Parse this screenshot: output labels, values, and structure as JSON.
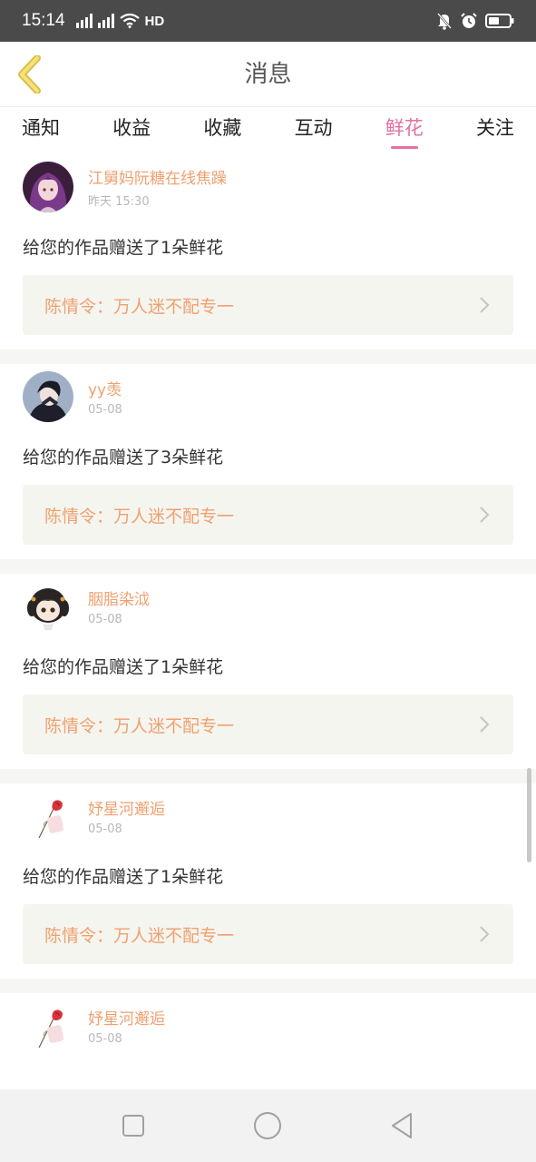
{
  "status_bar": {
    "time": "15:14",
    "signal1": "4G",
    "signal2": "4G",
    "hd": "HD"
  },
  "header": {
    "title": "消息",
    "back_icon": "chevron-left-icon"
  },
  "tabs": [
    {
      "label": "通知",
      "active": false
    },
    {
      "label": "收益",
      "active": false
    },
    {
      "label": "收藏",
      "active": false
    },
    {
      "label": "互动",
      "active": false
    },
    {
      "label": "鲜花",
      "active": true
    },
    {
      "label": "关注",
      "active": false
    }
  ],
  "colors": {
    "accent": "#e56fa1",
    "username": "#f0a070",
    "work_box_bg": "#f5f5ef"
  },
  "messages": [
    {
      "username": "江舅妈阮糖在线焦躁",
      "time": "昨天 15:30",
      "text": "给您的作品赠送了1朵鲜花",
      "work": "陈情令：万人迷不配专一",
      "avatar": "anime-girl-avatar"
    },
    {
      "username": "yy羡",
      "time": "05-08",
      "text": "给您的作品赠送了3朵鲜花",
      "work": "陈情令：万人迷不配专一",
      "avatar": "boy-avatar"
    },
    {
      "username": "胭脂染泧",
      "time": "05-08",
      "text": "给您的作品赠送了1朵鲜花",
      "work": "陈情令：万人迷不配专一",
      "avatar": "chibi-girl-avatar"
    },
    {
      "username": "妤星河邂逅",
      "time": "05-08",
      "text": "给您的作品赠送了1朵鲜花",
      "work": "陈情令：万人迷不配专一",
      "avatar": "rose-avatar"
    },
    {
      "username": "妤星河邂逅",
      "time": "05-08",
      "text": "",
      "work": "",
      "avatar": "rose-avatar"
    }
  ],
  "nav": {
    "recents_icon": "square-icon",
    "home_icon": "circle-icon",
    "back_icon": "triangle-back-icon"
  }
}
